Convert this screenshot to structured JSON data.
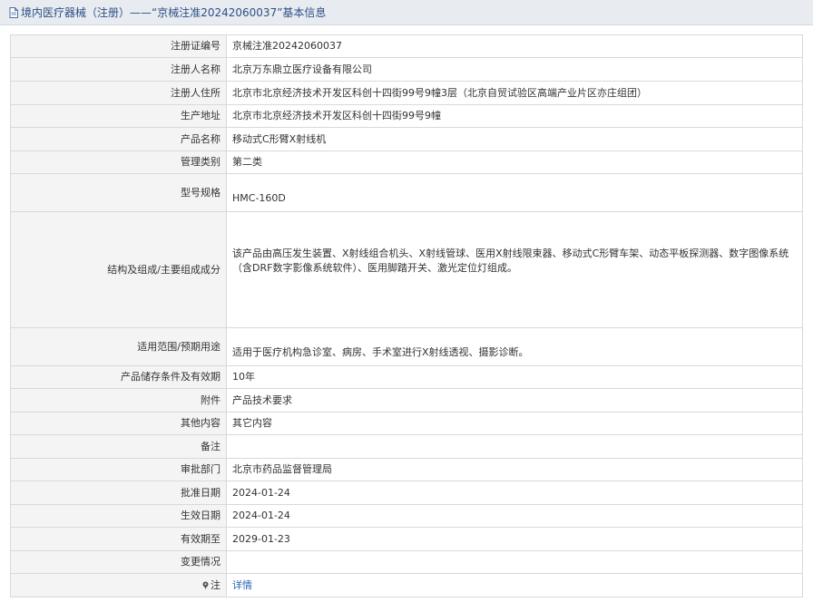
{
  "header": {
    "title": "境内医疗器械（注册）——“京械注准20242060037”基本信息"
  },
  "rows": [
    {
      "label": "注册证编号",
      "value": "京械注准20242060037"
    },
    {
      "label": "注册人名称",
      "value": "北京万东鼎立医疗设备有限公司"
    },
    {
      "label": "注册人住所",
      "value": "北京市北京经济技术开发区科创十四街99号9幢3层（北京自贸试验区高端产业片区亦庄组团）"
    },
    {
      "label": "生产地址",
      "value": "北京市北京经济技术开发区科创十四街99号9幢"
    },
    {
      "label": "产品名称",
      "value": "移动式C形臂X射线机"
    },
    {
      "label": "管理类别",
      "value": "第二类"
    },
    {
      "label": "型号规格",
      "value": "HMC-160D"
    },
    {
      "label": "结构及组成/主要组成成分",
      "value": "该产品由高压发生装置、X射线组合机头、X射线管球、医用X射线限束器、移动式C形臂车架、动态平板探测器、数字图像系统（含DRF数字影像系统软件）、医用脚踏开关、激光定位灯组成。"
    },
    {
      "label": "适用范围/预期用途",
      "value": "适用于医疗机构急诊室、病房、手术室进行X射线透视、摄影诊断。"
    },
    {
      "label": "产品储存条件及有效期",
      "value": "10年"
    },
    {
      "label": "附件",
      "value": "产品技术要求"
    },
    {
      "label": "其他内容",
      "value": "其它内容"
    },
    {
      "label": "备注",
      "value": ""
    },
    {
      "label": "审批部门",
      "value": "北京市药品监督管理局"
    },
    {
      "label": "批准日期",
      "value": "2024-01-24"
    },
    {
      "label": "生效日期",
      "value": "2024-01-24"
    },
    {
      "label": "有效期至",
      "value": "2029-01-23"
    },
    {
      "label": "变更情况",
      "value": ""
    },
    {
      "label": "注",
      "value": "详情"
    }
  ],
  "icons": {
    "header": "document-icon",
    "note": "pin-icon"
  },
  "colors": {
    "link": "#2a63b8",
    "title": "#2b4f86",
    "label_bg": "#f4f4f4"
  }
}
